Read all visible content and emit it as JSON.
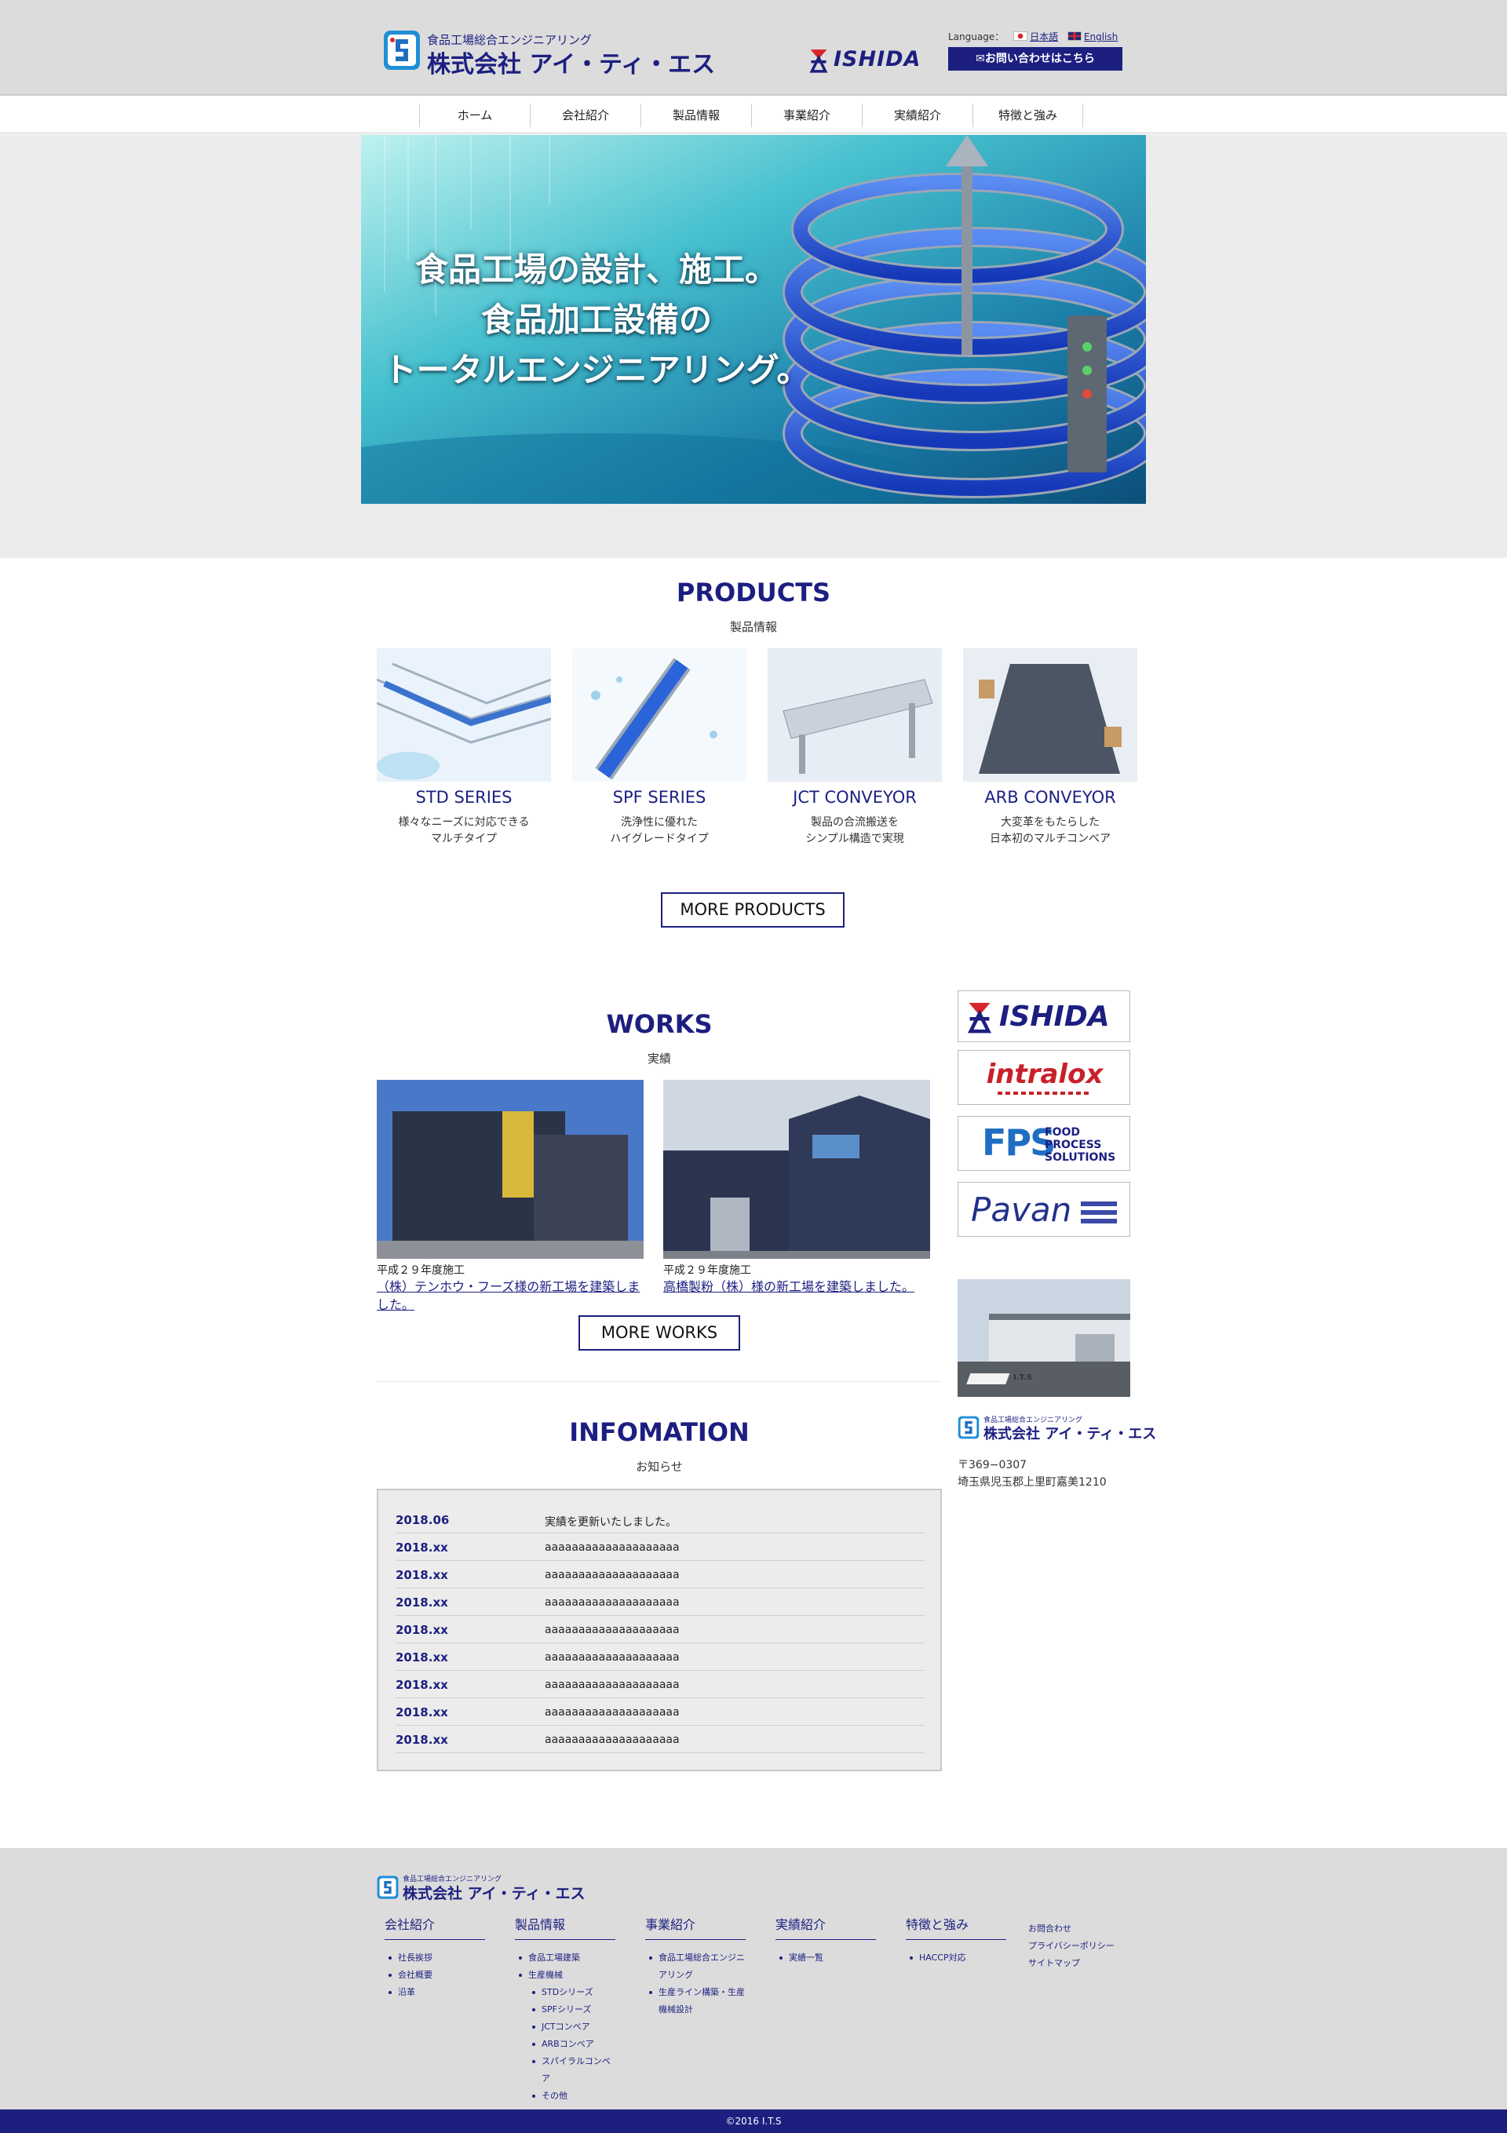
{
  "header": {
    "logo": {
      "tagline": "食品工場総合エンジニアリング",
      "company": "株式会社 アイ・ティ・エス"
    },
    "partner_logo": "ISHIDA",
    "language_label": "Language：",
    "lang_ja": "日本語",
    "lang_en": "English",
    "contact_button": "✉お問い合わせはこちら"
  },
  "nav": {
    "items": [
      {
        "label": "ホーム"
      },
      {
        "label": "会社紹介"
      },
      {
        "label": "製品情報"
      },
      {
        "label": "事業紹介"
      },
      {
        "label": "実績紹介"
      },
      {
        "label": "特徴と強み"
      }
    ]
  },
  "hero": {
    "lines": [
      "食品工場の設計、施工。",
      "食品加工設備の",
      "トータルエンジニアリング。"
    ]
  },
  "products": {
    "title": "PRODUCTS",
    "subtitle": "製品情報",
    "items": [
      {
        "name": "STD SERIES",
        "desc1": "様々なニーズに対応できる",
        "desc2": "マルチタイプ"
      },
      {
        "name": "SPF SERIES",
        "desc1": "洗浄性に優れた",
        "desc2": "ハイグレードタイプ"
      },
      {
        "name": "JCT CONVEYOR",
        "desc1": "製品の合流搬送を",
        "desc2": "シンプル構造で実現"
      },
      {
        "name": "ARB CONVEYOR",
        "desc1": "大変革をもたらした",
        "desc2": "日本初のマルチコンベア"
      }
    ],
    "more": "MORE PRODUCTS"
  },
  "works": {
    "title": "WORKS",
    "subtitle": "実績",
    "items": [
      {
        "date": "平成２９年度施工",
        "title": "（株）テンホウ・フーズ様の新工場を建築しました。"
      },
      {
        "date": "平成２９年度施工",
        "title": "高橋製粉（株）様の新工場を建築しました。"
      }
    ],
    "more": "MORE WORKS"
  },
  "info": {
    "title": "INFOMATION",
    "subtitle": "お知らせ",
    "items": [
      {
        "date": "2018.06",
        "text": "実績を更新いたしました。"
      },
      {
        "date": "2018.xx",
        "text": "aaaaaaaaaaaaaaaaaaaa"
      },
      {
        "date": "2018.xx",
        "text": "aaaaaaaaaaaaaaaaaaaa"
      },
      {
        "date": "2018.xx",
        "text": "aaaaaaaaaaaaaaaaaaaa"
      },
      {
        "date": "2018.xx",
        "text": "aaaaaaaaaaaaaaaaaaaa"
      },
      {
        "date": "2018.xx",
        "text": "aaaaaaaaaaaaaaaaaaaa"
      },
      {
        "date": "2018.xx",
        "text": "aaaaaaaaaaaaaaaaaaaa"
      },
      {
        "date": "2018.xx",
        "text": "aaaaaaaaaaaaaaaaaaaa"
      },
      {
        "date": "2018.xx",
        "text": "aaaaaaaaaaaaaaaaaaaa"
      }
    ]
  },
  "sidebar": {
    "partners": {
      "ishida": "ISHIDA",
      "intralox": "intralox",
      "fps": "FPS",
      "fps_sub1": "FOOD",
      "fps_sub2": "PROCESS",
      "fps_sub3": "SOLUTIONS",
      "pavan": "Pavan"
    },
    "photo_sign": "I.T.S",
    "logo": {
      "tagline": "食品工場総合エンジニアリング",
      "company": "株式会社 アイ・ティ・エス"
    },
    "postal": "〒369−0307",
    "address": "埼玉県児玉郡上里町嘉美1210"
  },
  "footer": {
    "logo": {
      "tagline": "食品工場総合エンジニアリング",
      "company": "株式会社 アイ・ティ・エス"
    },
    "columns": [
      {
        "heading": "会社紹介",
        "links": [
          "社長挨拶",
          "会社概要",
          "沿革"
        ]
      },
      {
        "heading": "製品情報",
        "links": [
          "食品工場建築",
          "生産機械"
        ],
        "sublinks": [
          "STDシリーズ",
          "SPFシリーズ",
          "JCTコンベア",
          "ARBコンベア",
          "スパイラルコンベア",
          "その他"
        ]
      },
      {
        "heading": "事業紹介",
        "links": [
          "食品工場総合エンジニアリング",
          "生産ライン構築・生産機械設計"
        ]
      },
      {
        "heading": "実績紹介",
        "links": [
          "実績一覧"
        ]
      },
      {
        "heading": "特徴と強み",
        "links": [
          "HACCP対応"
        ]
      }
    ],
    "misc": [
      "お問合わせ",
      "プライバシーポリシー",
      "サイトマップ"
    ],
    "copyright": "©2016 I.T.S"
  },
  "colors": {
    "brand_navy": "#1c1f80",
    "header_bg": "#dcdcdc",
    "band_bg": "#ececec",
    "ishida_red": "#d8252b",
    "hero_cyan": "#2fb3c9",
    "belt_blue": "#1b54d6"
  }
}
